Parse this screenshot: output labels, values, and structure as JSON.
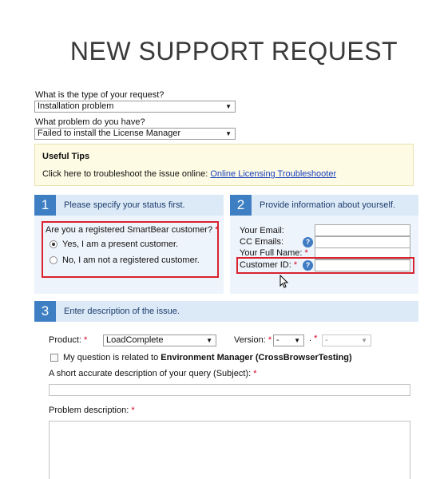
{
  "page_title": "NEW SUPPORT REQUEST",
  "request_type": {
    "label": "What is the type of your request?",
    "value": "Installation problem"
  },
  "problem": {
    "label": "What problem do you have?",
    "value": "Failed to install the License Manager"
  },
  "tips": {
    "heading": "Useful Tips",
    "text": "Click here to troubleshoot the issue online: ",
    "link": "Online Licensing Troubleshooter"
  },
  "section1": {
    "number": "1",
    "title": "Please specify your status first.",
    "question": "Are you a registered SmartBear customer?",
    "required_mark": "*",
    "options": [
      "Yes, I am a present customer.",
      "No, I am not a registered customer."
    ],
    "selected_index": 0
  },
  "section2": {
    "number": "2",
    "title": "Provide information about yourself.",
    "fields": {
      "email_label": "Your Email:",
      "cc_label": "CC Emails:",
      "name_label": "Your Full Name:",
      "customer_id_label": "Customer ID:"
    },
    "required_mark": "*",
    "help_glyph": "?"
  },
  "section3": {
    "number": "3",
    "title": "Enter description of the issue.",
    "product_label": "Product:",
    "product_value": "LoadComplete",
    "version_label": "Version:",
    "version_major": "-",
    "version_sep": ".",
    "version_minor": "-",
    "required_mark": "*",
    "env_manager_prefix": "My question is related to ",
    "env_manager_bold": "Environment Manager (CrossBrowserTesting)",
    "subject_label": "A short accurate description of your query (Subject):",
    "description_label": "Problem description:"
  },
  "colors": {
    "accent": "#3d7fc2",
    "section_header_bg": "#dce9f6",
    "highlight_red": "#d9232e",
    "tips_bg": "#fdfbe3",
    "link": "#1a3fbf"
  },
  "icons": [
    "help-icon",
    "dropdown-arrow-icon",
    "mouse-cursor-icon"
  ]
}
